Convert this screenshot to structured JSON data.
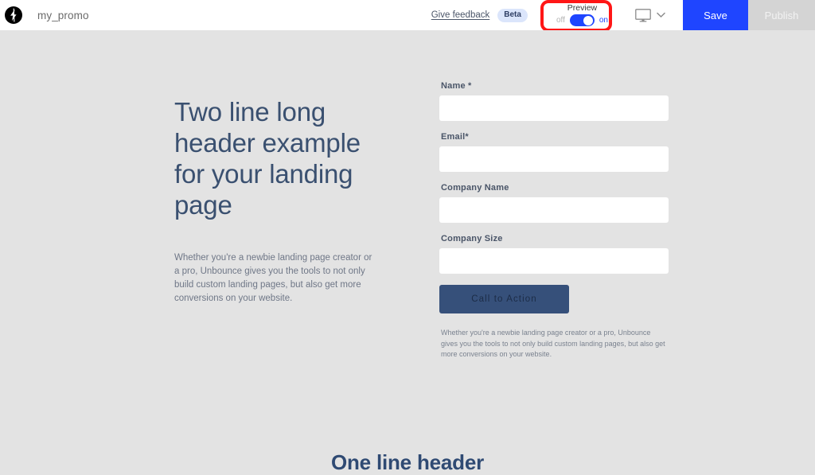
{
  "topbar": {
    "logo_icon": "unbounce-logo-icon",
    "document_title": "my_promo",
    "feedback_link": "Give feedback",
    "beta_badge": "Beta",
    "preview": {
      "title": "Preview",
      "off_label": "off",
      "on_label": "on",
      "state": "on"
    },
    "device_icon": "desktop-monitor-icon",
    "device_chevron_icon": "chevron-down-icon",
    "save_label": "Save",
    "publish_label": "Publish"
  },
  "annotation": {
    "target": "preview-toggle",
    "color": "#ff1616"
  },
  "canvas": {
    "hero_heading": "Two line long header example for your landing page",
    "hero_paragraph": "Whether you're a newbie landing page creator or a pro, Unbounce gives you the tools to not only build custom landing pages, but also get more conversions on your website.",
    "form": {
      "fields": [
        {
          "label": "Name *",
          "value": "",
          "placeholder": ""
        },
        {
          "label": "Email*",
          "value": "",
          "placeholder": ""
        },
        {
          "label": "Company Name",
          "value": "",
          "placeholder": ""
        },
        {
          "label": "Company Size",
          "value": "",
          "placeholder": ""
        }
      ],
      "cta_label": "Call to Action",
      "footnote": "Whether you're a newbie landing page creator or a pro, Unbounce gives you the tools to not only build custom landing pages, but also get more conversions on your website."
    },
    "bottom_heading": "One line header"
  },
  "colors": {
    "accent_blue": "#1f45ff",
    "heading_blue": "#3a5070",
    "cta_blue": "#36507a",
    "page_bg": "#e3e3e3",
    "annotation_red": "#ff1616"
  }
}
